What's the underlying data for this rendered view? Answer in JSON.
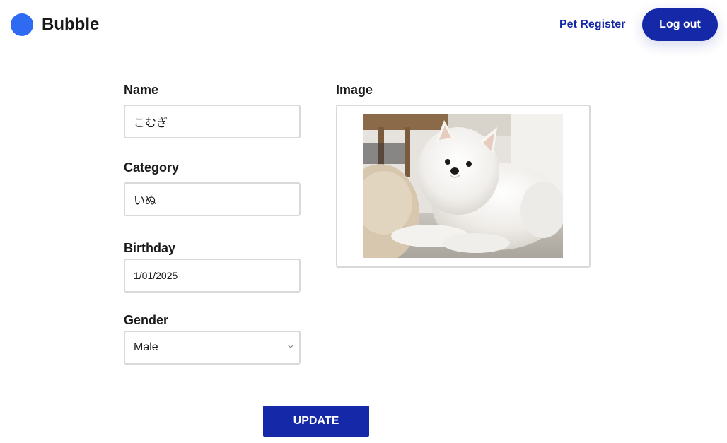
{
  "brand": {
    "name": "Bubble",
    "accent_color": "#2f6bf2"
  },
  "nav": {
    "pet_register": "Pet Register",
    "logout": "Log out",
    "primary_color": "#1428a8"
  },
  "form": {
    "name_label": "Name",
    "name_value": "こむぎ",
    "category_label": "Category",
    "category_value": "いぬ",
    "birthday_label": "Birthday",
    "birthday_value": "1/01/2025",
    "gender_label": "Gender",
    "gender_value": "Male",
    "image_label": "Image",
    "update_label": "UPDATE"
  },
  "icons": {
    "chevron": "chevron-down-icon",
    "logo": "logo-circle-icon",
    "photo": "dog-photo"
  }
}
